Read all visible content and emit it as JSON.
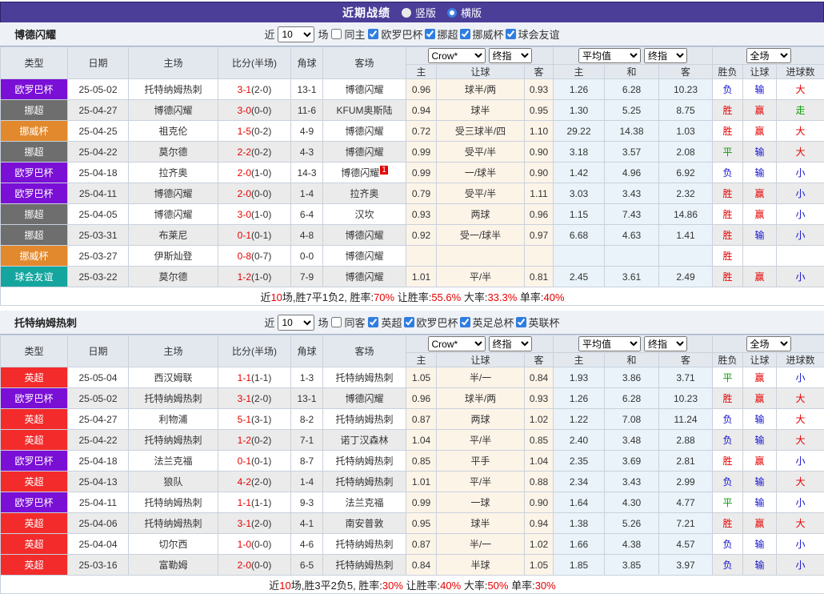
{
  "title_bar": {
    "title": "近期战绩",
    "vertical_label": "竖版",
    "horizontal_label": "横版",
    "bar_color": "#4a3e99"
  },
  "columns": {
    "type": "类型",
    "date": "日期",
    "home": "主场",
    "score": "比分(半场)",
    "corner": "角球",
    "away": "客场",
    "h_home": "主",
    "h_line": "让球",
    "h_away": "客",
    "o_home": "主",
    "o_draw": "和",
    "o_away": "客",
    "r_wl": "胜负",
    "r_line": "让球",
    "r_goals": "进球数"
  },
  "selects": {
    "company": "Crow*",
    "final1": "终指",
    "average": "平均值",
    "final2": "终指",
    "scope": "全场"
  },
  "filter_text": {
    "near": "近",
    "games": "场"
  },
  "league_colors": {
    "欧罗巴杯": "#7a0fd6",
    "挪超": "#6e6e6e",
    "挪威杯": "#e2892d",
    "球会友谊": "#14a59e",
    "英超": "#f32b2b"
  },
  "result_colors": {
    "win": "#e60000",
    "lose": "#1212d0",
    "draw": "#089b08"
  },
  "sections": [
    {
      "team": "博德闪耀",
      "filter": {
        "count": "10",
        "same_label": "同主",
        "leagues": [
          "欧罗巴杯",
          "挪超",
          "挪威杯",
          "球会友谊"
        ]
      },
      "rows": [
        {
          "league": "欧罗巴杯",
          "date": "25-05-02",
          "home": "托特纳姆热刺",
          "hf": false,
          "score": "3-1",
          "half": "(2-0)",
          "corner": "13-1",
          "away": "博德闪耀",
          "af": true,
          "badge": "",
          "o1": "0.96",
          "line": "球半/两",
          "o2": "0.93",
          "a1": "1.26",
          "a2": "6.28",
          "a3": "10.23",
          "r1": "负",
          "c1": "blue",
          "r2": "输",
          "c2": "blue",
          "r3": "大",
          "c3": "red"
        },
        {
          "league": "挪超",
          "date": "25-04-27",
          "home": "博德闪耀",
          "hf": true,
          "score": "3-0",
          "half": "(0-0)",
          "corner": "11-6",
          "away": "KFUM奥斯陆",
          "af": false,
          "badge": "",
          "o1": "0.94",
          "line": "球半",
          "o2": "0.95",
          "a1": "1.30",
          "a2": "5.25",
          "a3": "8.75",
          "r1": "胜",
          "c1": "red",
          "r2": "赢",
          "c2": "red",
          "r3": "走",
          "c3": "green"
        },
        {
          "league": "挪威杯",
          "date": "25-04-25",
          "home": "祖克伦",
          "hf": false,
          "score": "1-5",
          "half": "(0-2)",
          "corner": "4-9",
          "away": "博德闪耀",
          "af": true,
          "badge": "",
          "o1": "0.72",
          "line": "受三球半/四",
          "o2": "1.10",
          "a1": "29.22",
          "a2": "14.38",
          "a3": "1.03",
          "r1": "胜",
          "c1": "red",
          "r2": "赢",
          "c2": "red",
          "r3": "大",
          "c3": "red"
        },
        {
          "league": "挪超",
          "date": "25-04-22",
          "home": "莫尔德",
          "hf": false,
          "score": "2-2",
          "half": "(0-2)",
          "corner": "4-3",
          "away": "博德闪耀",
          "af": true,
          "badge": "",
          "o1": "0.99",
          "line": "受平/半",
          "o2": "0.90",
          "a1": "3.18",
          "a2": "3.57",
          "a3": "2.08",
          "r1": "平",
          "c1": "green",
          "r2": "输",
          "c2": "blue",
          "r3": "大",
          "c3": "red"
        },
        {
          "league": "欧罗巴杯",
          "date": "25-04-18",
          "home": "拉齐奥",
          "hf": false,
          "score": "2-0",
          "half": "(1-0)",
          "corner": "14-3",
          "away": "博德闪耀",
          "af": true,
          "badge": "1",
          "o1": "0.99",
          "line": "一/球半",
          "o2": "0.90",
          "a1": "1.42",
          "a2": "4.96",
          "a3": "6.92",
          "r1": "负",
          "c1": "blue",
          "r2": "输",
          "c2": "blue",
          "r3": "小",
          "c3": "blue"
        },
        {
          "league": "欧罗巴杯",
          "date": "25-04-11",
          "home": "博德闪耀",
          "hf": true,
          "score": "2-0",
          "half": "(0-0)",
          "corner": "1-4",
          "away": "拉齐奥",
          "af": false,
          "badge": "",
          "o1": "0.79",
          "line": "受平/半",
          "o2": "1.11",
          "a1": "3.03",
          "a2": "3.43",
          "a3": "2.32",
          "r1": "胜",
          "c1": "red",
          "r2": "赢",
          "c2": "red",
          "r3": "小",
          "c3": "blue"
        },
        {
          "league": "挪超",
          "date": "25-04-05",
          "home": "博德闪耀",
          "hf": true,
          "score": "3-0",
          "half": "(1-0)",
          "corner": "6-4",
          "away": "汉坎",
          "af": false,
          "badge": "",
          "o1": "0.93",
          "line": "两球",
          "o2": "0.96",
          "a1": "1.15",
          "a2": "7.43",
          "a3": "14.86",
          "r1": "胜",
          "c1": "red",
          "r2": "赢",
          "c2": "red",
          "r3": "小",
          "c3": "blue"
        },
        {
          "league": "挪超",
          "date": "25-03-31",
          "home": "布莱尼",
          "hf": false,
          "score": "0-1",
          "half": "(0-1)",
          "corner": "4-8",
          "away": "博德闪耀",
          "af": true,
          "badge": "",
          "o1": "0.92",
          "line": "受一/球半",
          "o2": "0.97",
          "a1": "6.68",
          "a2": "4.63",
          "a3": "1.41",
          "r1": "胜",
          "c1": "red",
          "r2": "输",
          "c2": "blue",
          "r3": "小",
          "c3": "blue"
        },
        {
          "league": "挪威杯",
          "date": "25-03-27",
          "home": "伊斯灿登",
          "hf": false,
          "score": "0-8",
          "half": "(0-7)",
          "corner": "0-0",
          "away": "博德闪耀",
          "af": true,
          "badge": "",
          "o1": "",
          "line": "",
          "o2": "",
          "a1": "",
          "a2": "",
          "a3": "",
          "r1": "胜",
          "c1": "red",
          "r2": "",
          "c2": "none",
          "r3": "",
          "c3": "none"
        },
        {
          "league": "球会友谊",
          "date": "25-03-22",
          "home": "莫尔德",
          "hf": false,
          "score": "1-2",
          "half": "(1-0)",
          "corner": "7-9",
          "away": "博德闪耀",
          "af": true,
          "badge": "",
          "o1": "1.01",
          "line": "平/半",
          "o2": "0.81",
          "a1": "2.45",
          "a2": "3.61",
          "a3": "2.49",
          "r1": "胜",
          "c1": "red",
          "r2": "赢",
          "c2": "red",
          "r3": "小",
          "c3": "blue"
        }
      ],
      "summary": [
        "近",
        "10",
        "场,胜7平1负2, 胜率:",
        "70%",
        " 让胜率:",
        "55.6%",
        " 大率:",
        "33.3%",
        " 单率:",
        "40%"
      ]
    },
    {
      "team": "托特纳姆热刺",
      "filter": {
        "count": "10",
        "same_label": "同客",
        "leagues": [
          "英超",
          "欧罗巴杯",
          "英足总杯",
          "英联杯"
        ]
      },
      "rows": [
        {
          "league": "英超",
          "date": "25-05-04",
          "home": "西汉姆联",
          "hf": false,
          "score": "1-1",
          "half": "(1-1)",
          "corner": "1-3",
          "away": "托特纳姆热刺",
          "af": true,
          "badge": "",
          "o1": "1.05",
          "line": "半/一",
          "o2": "0.84",
          "a1": "1.93",
          "a2": "3.86",
          "a3": "3.71",
          "r1": "平",
          "c1": "green",
          "r2": "赢",
          "c2": "red",
          "r3": "小",
          "c3": "blue"
        },
        {
          "league": "欧罗巴杯",
          "date": "25-05-02",
          "home": "托特纳姆热刺",
          "hf": true,
          "score": "3-1",
          "half": "(2-0)",
          "corner": "13-1",
          "away": "博德闪耀",
          "af": false,
          "badge": "",
          "o1": "0.96",
          "line": "球半/两",
          "o2": "0.93",
          "a1": "1.26",
          "a2": "6.28",
          "a3": "10.23",
          "r1": "胜",
          "c1": "red",
          "r2": "赢",
          "c2": "red",
          "r3": "大",
          "c3": "red"
        },
        {
          "league": "英超",
          "date": "25-04-27",
          "home": "利物浦",
          "hf": false,
          "score": "5-1",
          "half": "(3-1)",
          "corner": "8-2",
          "away": "托特纳姆热刺",
          "af": true,
          "badge": "",
          "o1": "0.87",
          "line": "两球",
          "o2": "1.02",
          "a1": "1.22",
          "a2": "7.08",
          "a3": "11.24",
          "r1": "负",
          "c1": "blue",
          "r2": "输",
          "c2": "blue",
          "r3": "大",
          "c3": "red"
        },
        {
          "league": "英超",
          "date": "25-04-22",
          "home": "托特纳姆热刺",
          "hf": true,
          "score": "1-2",
          "half": "(0-2)",
          "corner": "7-1",
          "away": "诺丁汉森林",
          "af": false,
          "badge": "",
          "o1": "1.04",
          "line": "平/半",
          "o2": "0.85",
          "a1": "2.40",
          "a2": "3.48",
          "a3": "2.88",
          "r1": "负",
          "c1": "blue",
          "r2": "输",
          "c2": "blue",
          "r3": "大",
          "c3": "red"
        },
        {
          "league": "欧罗巴杯",
          "date": "25-04-18",
          "home": "法兰克福",
          "hf": false,
          "score": "0-1",
          "half": "(0-1)",
          "corner": "8-7",
          "away": "托特纳姆热刺",
          "af": true,
          "badge": "",
          "o1": "0.85",
          "line": "平手",
          "o2": "1.04",
          "a1": "2.35",
          "a2": "3.69",
          "a3": "2.81",
          "r1": "胜",
          "c1": "red",
          "r2": "赢",
          "c2": "red",
          "r3": "小",
          "c3": "blue"
        },
        {
          "league": "英超",
          "date": "25-04-13",
          "home": "狼队",
          "hf": false,
          "score": "4-2",
          "half": "(2-0)",
          "corner": "1-4",
          "away": "托特纳姆热刺",
          "af": true,
          "badge": "",
          "o1": "1.01",
          "line": "平/半",
          "o2": "0.88",
          "a1": "2.34",
          "a2": "3.43",
          "a3": "2.99",
          "r1": "负",
          "c1": "blue",
          "r2": "输",
          "c2": "blue",
          "r3": "大",
          "c3": "red"
        },
        {
          "league": "欧罗巴杯",
          "date": "25-04-11",
          "home": "托特纳姆热刺",
          "hf": true,
          "score": "1-1",
          "half": "(1-1)",
          "corner": "9-3",
          "away": "法兰克福",
          "af": false,
          "badge": "",
          "o1": "0.99",
          "line": "一球",
          "o2": "0.90",
          "a1": "1.64",
          "a2": "4.30",
          "a3": "4.77",
          "r1": "平",
          "c1": "green",
          "r2": "输",
          "c2": "blue",
          "r3": "小",
          "c3": "blue"
        },
        {
          "league": "英超",
          "date": "25-04-06",
          "home": "托特纳姆热刺",
          "hf": true,
          "score": "3-1",
          "half": "(2-0)",
          "corner": "4-1",
          "away": "南安普敦",
          "af": false,
          "badge": "",
          "o1": "0.95",
          "line": "球半",
          "o2": "0.94",
          "a1": "1.38",
          "a2": "5.26",
          "a3": "7.21",
          "r1": "胜",
          "c1": "red",
          "r2": "赢",
          "c2": "red",
          "r3": "大",
          "c3": "red"
        },
        {
          "league": "英超",
          "date": "25-04-04",
          "home": "切尔西",
          "hf": false,
          "score": "1-0",
          "half": "(0-0)",
          "corner": "4-6",
          "away": "托特纳姆热刺",
          "af": true,
          "badge": "",
          "o1": "0.87",
          "line": "半/一",
          "o2": "1.02",
          "a1": "1.66",
          "a2": "4.38",
          "a3": "4.57",
          "r1": "负",
          "c1": "blue",
          "r2": "输",
          "c2": "blue",
          "r3": "小",
          "c3": "blue"
        },
        {
          "league": "英超",
          "date": "25-03-16",
          "home": "富勒姆",
          "hf": false,
          "score": "2-0",
          "half": "(0-0)",
          "corner": "6-5",
          "away": "托特纳姆热刺",
          "af": true,
          "badge": "",
          "o1": "0.84",
          "line": "半球",
          "o2": "1.05",
          "a1": "1.85",
          "a2": "3.85",
          "a3": "3.97",
          "r1": "负",
          "c1": "blue",
          "r2": "输",
          "c2": "blue",
          "r3": "小",
          "c3": "blue"
        }
      ],
      "summary": [
        "近",
        "10",
        "场,胜3平2负5, 胜率:",
        "30%",
        " 让胜率:",
        "40%",
        " 大率:",
        "50%",
        " 单率:",
        "30%"
      ]
    }
  ]
}
